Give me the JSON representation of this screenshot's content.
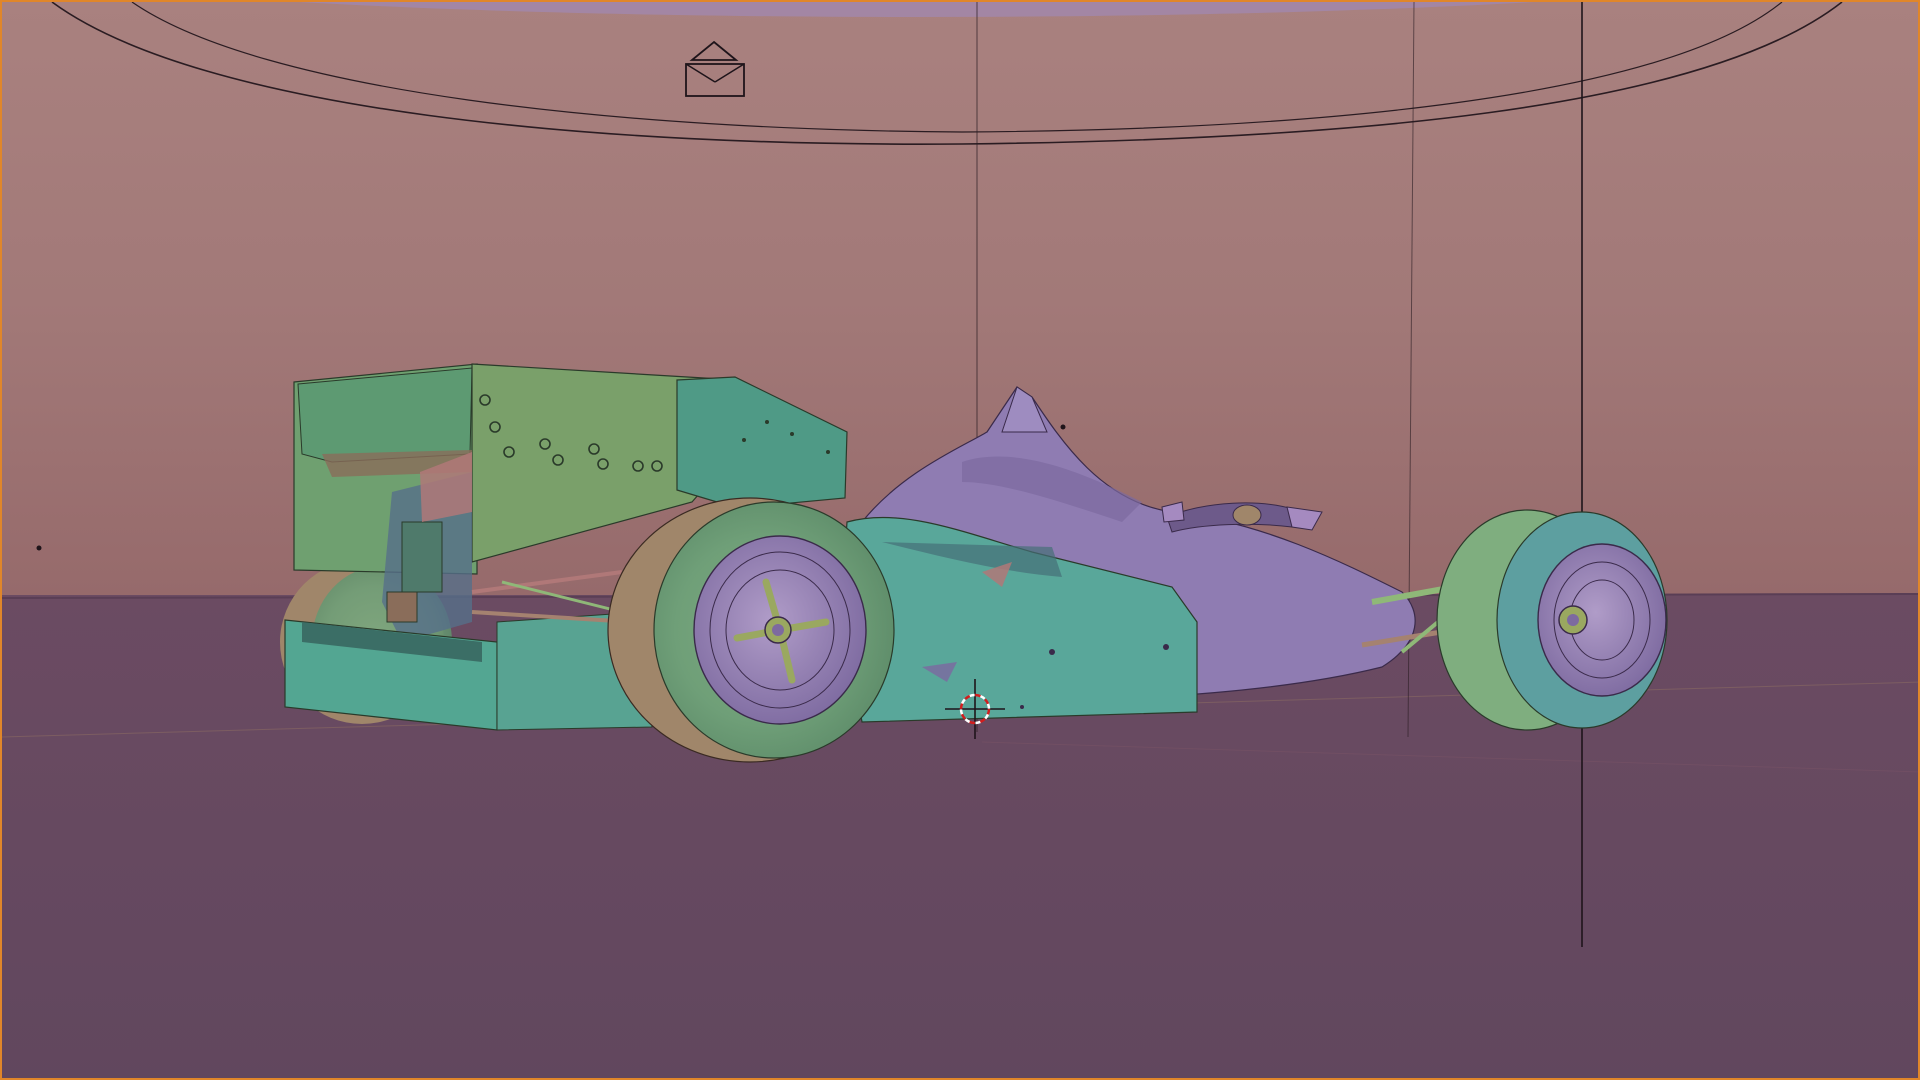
{
  "viewport": {
    "mode": "3D Viewport",
    "shading": "solid",
    "active_outline_color": "#e0862a",
    "wall_color": "#a37c7d",
    "floor_color": "#64485f"
  },
  "scene": {
    "object": "formula-one-car",
    "icons": [
      "camera-icon",
      "3d-cursor-icon",
      "empty-object-icon"
    ],
    "colors": {
      "body_green": "#5fa883",
      "body_teal": "#59a79a",
      "body_purple": "#8f7cb2",
      "tyre_green": "#7fae7f",
      "tyre_tan": "#a0866a",
      "rim_purple": "#a18bc0"
    }
  }
}
